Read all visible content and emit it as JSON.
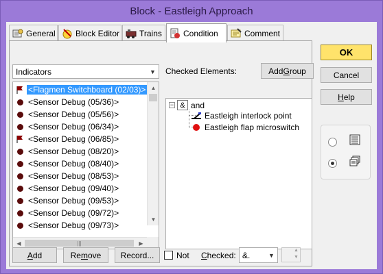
{
  "window": {
    "title": "Block - Eastleigh Approach"
  },
  "tabs": [
    {
      "label": "General",
      "icon": "general-icon"
    },
    {
      "label": "Block Editor",
      "icon": "block-editor-icon"
    },
    {
      "label": "Trains",
      "icon": "trains-icon"
    },
    {
      "label": "Condition",
      "icon": "condition-icon",
      "active": true
    },
    {
      "label": "Comment",
      "icon": "comment-icon"
    }
  ],
  "buttons": {
    "ok": "OK",
    "cancel": "Cancel",
    "help_u": "H",
    "help_rest": "elp",
    "add_group_pre": "Add ",
    "add_group_u": "G",
    "add_group_post": "roup",
    "add_u": "A",
    "add_rest": "dd",
    "remove_pre": "Re",
    "remove_u": "m",
    "remove_post": "ove",
    "record": "Record..."
  },
  "filter": {
    "value": "Indicators"
  },
  "checked_elements_label": "Checked Elements:",
  "list": {
    "items": [
      {
        "label": "<Flagmen Switchboard (02/03)>",
        "icon": "flag-icon",
        "selected": true
      },
      {
        "label": "<Sensor Debug (05/36)>",
        "icon": "sensor-dot-icon"
      },
      {
        "label": "<Sensor Debug (05/56)>",
        "icon": "sensor-dot-icon"
      },
      {
        "label": "<Sensor Debug (06/34)>",
        "icon": "sensor-dot-icon"
      },
      {
        "label": "<Sensor Debug (06/85)>",
        "icon": "flag-icon"
      },
      {
        "label": "<Sensor Debug (08/20)>",
        "icon": "sensor-dot-icon"
      },
      {
        "label": "<Sensor Debug (08/40)>",
        "icon": "sensor-dot-icon"
      },
      {
        "label": "<Sensor Debug (08/53)>",
        "icon": "sensor-dot-icon"
      },
      {
        "label": "<Sensor Debug (09/40)>",
        "icon": "sensor-dot-icon"
      },
      {
        "label": "<Sensor Debug (09/53)>",
        "icon": "sensor-dot-icon"
      },
      {
        "label": "<Sensor Debug (09/72)>",
        "icon": "sensor-dot-icon"
      },
      {
        "label": "<Sensor Debug (09/73)>",
        "icon": "sensor-dot-icon"
      }
    ]
  },
  "tree": {
    "root": {
      "operator": "&",
      "label": "and"
    },
    "children": [
      {
        "label": "Eastleigh interlock point",
        "icon": "turnout-icon"
      },
      {
        "label": "Eastleigh flap microswitch",
        "icon": "red-dot-icon"
      }
    ]
  },
  "bottom": {
    "not_label": "Not",
    "checked_pre": "",
    "checked_u": "C",
    "checked_post": "hecked:",
    "checked_value": "&."
  },
  "colors": {
    "title_bar": "#9b7ad8",
    "selection": "#3399ff",
    "ok_button": "#ffe36b",
    "sensor_dot": "#5a0b0b",
    "flag": "#8b0000"
  }
}
